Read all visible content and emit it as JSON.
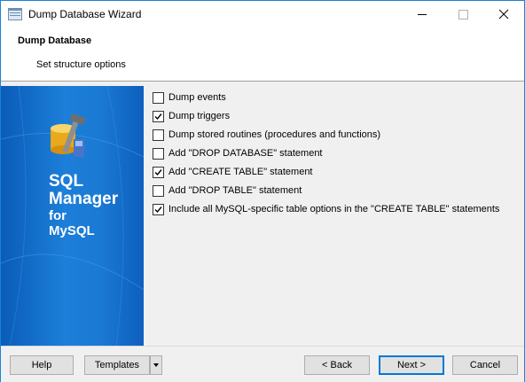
{
  "window": {
    "title": "Dump Database Wizard"
  },
  "header": {
    "title": "Dump Database",
    "subtitle": "Set structure options"
  },
  "banner": {
    "line1": "SQL",
    "line2": "Manager",
    "line3": "for",
    "line4": "MySQL"
  },
  "options": [
    {
      "label": "Dump events",
      "checked": false
    },
    {
      "label": "Dump triggers",
      "checked": true
    },
    {
      "label": "Dump stored routines (procedures and functions)",
      "checked": false
    },
    {
      "label": "Add \"DROP DATABASE\" statement",
      "checked": false
    },
    {
      "label": "Add \"CREATE TABLE\" statement",
      "checked": true
    },
    {
      "label": "Add \"DROP TABLE\" statement",
      "checked": false
    },
    {
      "label": "Include all MySQL-specific table options in the \"CREATE TABLE\" statements",
      "checked": true
    }
  ],
  "footer": {
    "help": "Help",
    "templates": "Templates",
    "back": "< Back",
    "next": "Next >",
    "cancel": "Cancel"
  }
}
